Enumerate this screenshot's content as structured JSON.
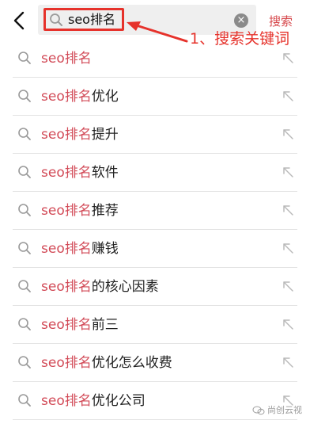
{
  "header": {
    "search_value": "seo排名",
    "clear_glyph": "×",
    "search_button_label": "搜索",
    "icons": {
      "back": "chevron-left-icon",
      "search": "search-icon",
      "clear": "clear-icon"
    }
  },
  "annotation": {
    "label": "1、搜索关键词",
    "color": "#e6322b"
  },
  "suggestions": [
    {
      "highlight": "seo排名",
      "rest": ""
    },
    {
      "highlight": "seo排名",
      "rest": "优化"
    },
    {
      "highlight": "seo排名",
      "rest": "提升"
    },
    {
      "highlight": "seo排名",
      "rest": "软件"
    },
    {
      "highlight": "seo排名",
      "rest": "推荐"
    },
    {
      "highlight": "seo排名",
      "rest": "赚钱"
    },
    {
      "highlight": "seo排名",
      "rest": "的核心因素"
    },
    {
      "highlight": "seo排名",
      "rest": "前三"
    },
    {
      "highlight": "seo排名",
      "rest": "优化怎么收费"
    },
    {
      "highlight": "seo排名",
      "rest": "优化公司"
    }
  ],
  "watermark": {
    "text": "尚创云视"
  },
  "colors": {
    "highlight": "#d24a57",
    "accent": "#d6464a",
    "divider": "#e3e3e3"
  }
}
